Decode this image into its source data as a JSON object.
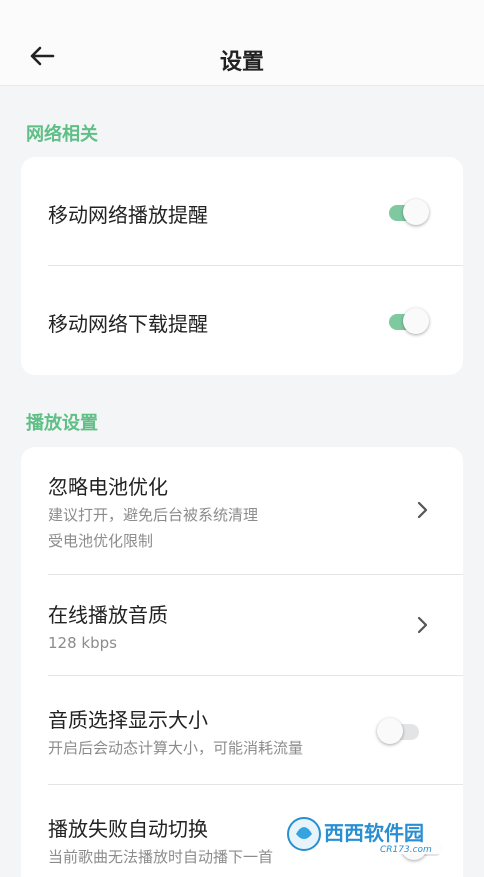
{
  "colors": {
    "accent": "#5fbf86",
    "toggle_on_track": "#7fc9a0",
    "toggle_off_track": "#e2e4e6",
    "background": "#f3f5f7"
  },
  "header": {
    "title": "设置",
    "back_icon": "arrow-left-icon"
  },
  "sections": [
    {
      "title": "网络相关",
      "items": [
        {
          "title": "移动网络播放提醒",
          "control": "toggle",
          "value": true
        },
        {
          "title": "移动网络下载提醒",
          "control": "toggle",
          "value": true
        }
      ]
    },
    {
      "title": "播放设置",
      "items": [
        {
          "title": "忽略电池优化",
          "sub1": "建议打开，避免后台被系统清理",
          "sub2": "受电池优化限制",
          "control": "chevron"
        },
        {
          "title": "在线播放音质",
          "sub1": "128 kbps",
          "control": "chevron"
        },
        {
          "title": "音质选择显示大小",
          "sub1": "开启后会动态计算大小，可能消耗流量",
          "control": "toggle",
          "value": false
        },
        {
          "title": "播放失败自动切换",
          "sub1": "当前歌曲无法播放时自动播下一首",
          "control": "toggle",
          "value": false
        }
      ]
    }
  ],
  "watermark": {
    "brand": "西西软件园",
    "url": "CR173.com"
  }
}
